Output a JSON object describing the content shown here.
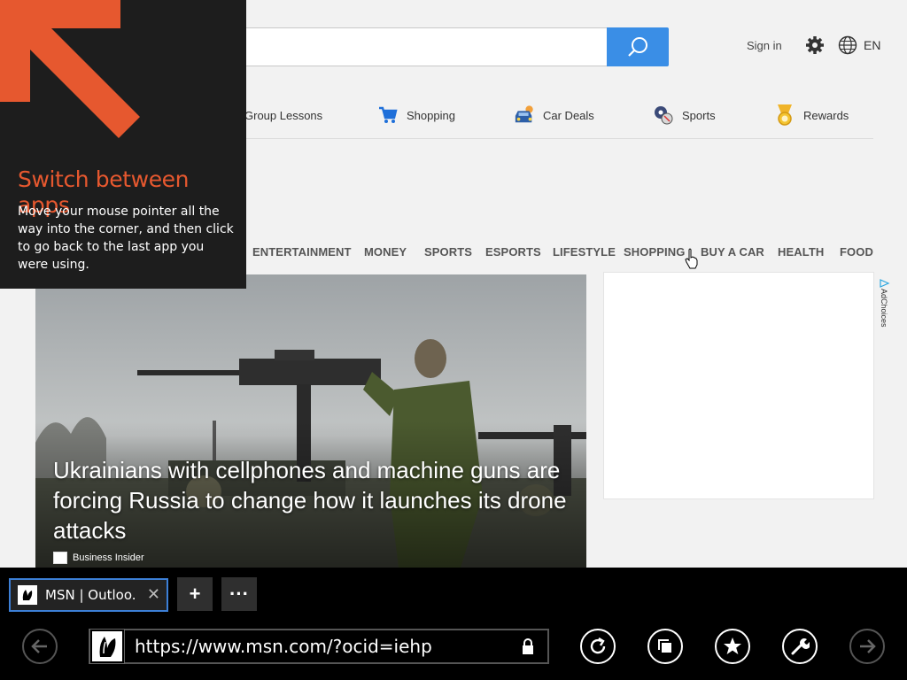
{
  "header": {
    "search_placeholder": "",
    "sign_in": "Sign in",
    "language": "EN"
  },
  "quick_links": [
    {
      "label": "Group Lessons",
      "icon": "group-lessons-icon"
    },
    {
      "label": "Shopping",
      "icon": "shopping-cart-icon"
    },
    {
      "label": "Car Deals",
      "icon": "car-icon"
    },
    {
      "label": "Sports",
      "icon": "sports-ball-icon"
    },
    {
      "label": "Rewards",
      "icon": "medal-icon"
    }
  ],
  "nav": [
    "ENTERTAINMENT",
    "MONEY",
    "SPORTS",
    "ESPORTS",
    "LIFESTYLE",
    "SHOPPING",
    "BUY A CAR",
    "HEALTH",
    "FOOD"
  ],
  "hero": {
    "headline": "Ukrainians with cellphones and machine guns are forcing Russia to change how it launches its drone attacks",
    "source": "Business Insider"
  },
  "ad": {
    "adchoices": "AdChoices"
  },
  "tip": {
    "title": "Switch between apps",
    "body": "Move your mouse pointer all the way into the corner, and then click to go back to the last app you were using."
  },
  "browser": {
    "tab_title": "MSN | Outloo...",
    "tab_close": "✕",
    "new_tab": "+",
    "more": "···",
    "url": "https://www.msn.com/?ocid=iehp"
  },
  "colors": {
    "accent_blue": "#3a8ee6",
    "tip_orange": "#e6582f",
    "tab_border": "#3c7fd6"
  }
}
